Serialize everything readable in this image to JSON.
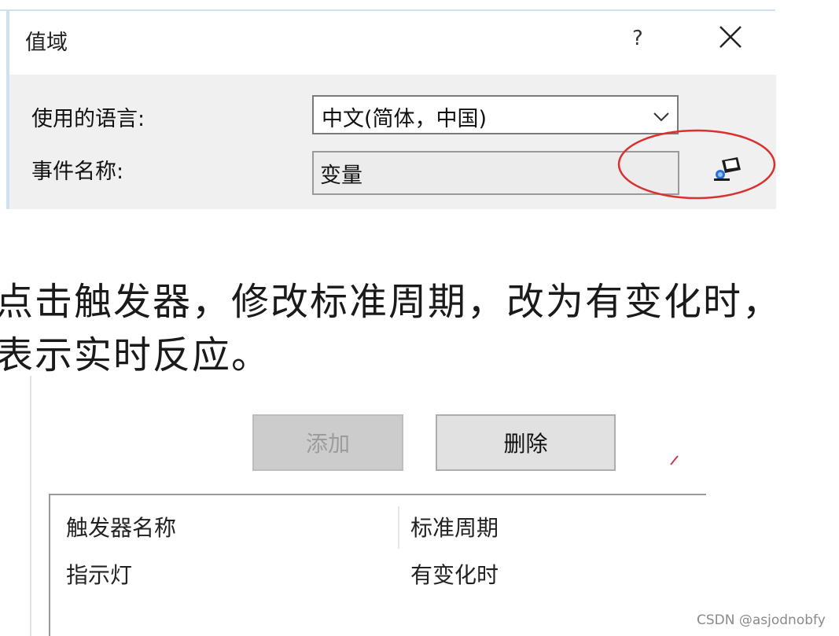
{
  "dialog": {
    "title": "值域",
    "help_label": "?",
    "close_icon": "close-icon",
    "language_label": "使用的语言:",
    "language_value": "中文(简体，中国)",
    "event_label": "事件名称:",
    "event_value": "变量",
    "picker_icon": "variable-picker-icon",
    "highlight_color": "#d93030"
  },
  "instruction": {
    "line1": "点击触发器，修改标准周期，改为有变化时，",
    "line2": "表示实时反应。"
  },
  "panel": {
    "add_label": "添加",
    "delete_label": "删除",
    "table": {
      "headers": [
        "触发器名称",
        "标准周期"
      ],
      "rows": [
        [
          "指示灯",
          "有变化时"
        ]
      ]
    }
  },
  "watermark": "CSDN @asjodnobfy"
}
